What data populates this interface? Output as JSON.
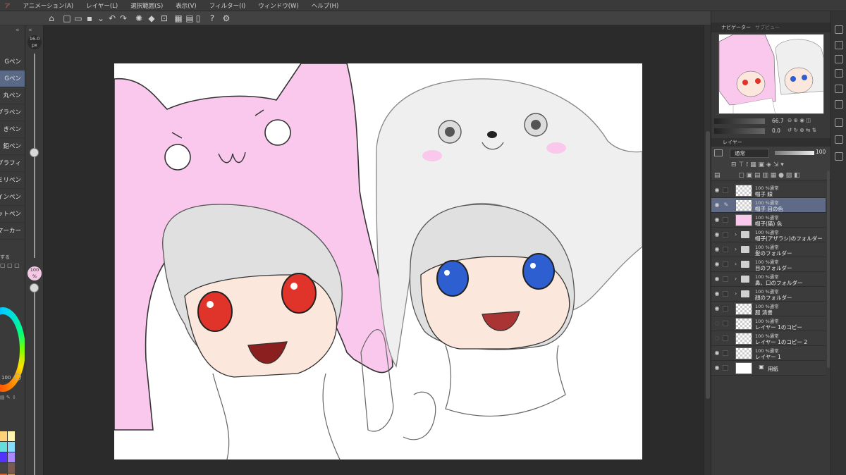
{
  "menu": {
    "items": [
      "ア",
      "アニメーション(A)",
      "レイヤー(L)",
      "選択範囲(S)",
      "表示(V)",
      "フィルター(I)",
      "ウィンドウ(W)",
      "ヘルプ(H)"
    ]
  },
  "tool_list": {
    "items": [
      "Gペン",
      "Gペン",
      "丸ペン",
      "グラペン",
      "きペン",
      "鉛ペン",
      "グラフィ",
      "ミリペン",
      "インペン",
      "ットペン",
      "マーカー"
    ],
    "selected_index": 1
  },
  "brush": {
    "size_value": "16.0",
    "size_unit": "px",
    "opacity_value": "100",
    "opacity_unit": "%",
    "dial_value": "100",
    "misc_label": "する"
  },
  "palette": {
    "colors": [
      "#ffd27a",
      "#fff3b0",
      "#66dddd",
      "#88ddff",
      "#5533ff",
      "#aa88ff",
      "#444444",
      "#7a5a50",
      "#cc6633",
      "#b89060",
      "#222222",
      "#5a3020"
    ]
  },
  "panels": {
    "navigator_tab": "ナビゲーター",
    "sub_tab": "サブビュー",
    "zoom_value": "66.7",
    "rotation_value": "0.0",
    "layer_tab": "レイヤー",
    "blend_mode": "通常",
    "layer_opacity": "100"
  },
  "layers": [
    {
      "mode": "100 %通常",
      "name": "帽子 線",
      "type": "layer",
      "visible": true,
      "selected": false
    },
    {
      "mode": "100 %通常",
      "name": "帽子 目の色",
      "type": "layer",
      "visible": true,
      "selected": true
    },
    {
      "mode": "100 %通常",
      "name": "帽子(猫) 色",
      "type": "layer-pink",
      "visible": true,
      "selected": false
    },
    {
      "mode": "100 %通常",
      "name": "帽子(アザラシ)のフォルダー",
      "type": "folder",
      "visible": true,
      "selected": false
    },
    {
      "mode": "100 %通常",
      "name": "髪のフォルダー",
      "type": "folder",
      "visible": true,
      "selected": false
    },
    {
      "mode": "100 %通常",
      "name": "目のフォルダー",
      "type": "folder",
      "visible": true,
      "selected": false
    },
    {
      "mode": "100 %通常",
      "name": "鼻、口のフォルダー",
      "type": "folder",
      "visible": true,
      "selected": false
    },
    {
      "mode": "100 %通常",
      "name": "顔のフォルダー",
      "type": "folder",
      "visible": true,
      "selected": false
    },
    {
      "mode": "100 %通常",
      "name": "服 清書",
      "type": "layer",
      "visible": true,
      "selected": false
    },
    {
      "mode": "100 %通常",
      "name": "レイヤー 1のコピー",
      "type": "layer",
      "visible": false,
      "selected": false
    },
    {
      "mode": "100 %通常",
      "name": "レイヤー 1のコピー 2",
      "type": "layer",
      "visible": false,
      "selected": false
    },
    {
      "mode": "100 %通常",
      "name": "レイヤー 1",
      "type": "layer",
      "visible": true,
      "selected": false
    },
    {
      "mode": "",
      "name": "用紙",
      "type": "paper",
      "visible": true,
      "selected": false
    }
  ],
  "colors": {
    "hat_pink": "#f9c8ec",
    "seal_gray": "#efefef",
    "skin": "#fbe7dc",
    "hair": "#e0e0e0",
    "red_eye": "#e0332a",
    "blue_eye": "#2d5fd0",
    "selection": "#5f6a86"
  }
}
